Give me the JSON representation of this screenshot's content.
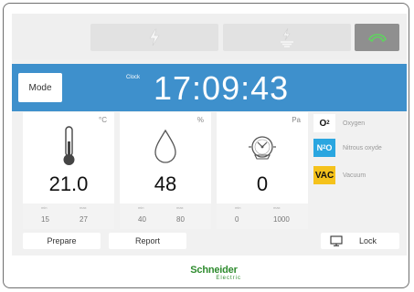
{
  "header": {
    "mode_label": "Mode",
    "clock_label": "Clock",
    "clock_time": "17:09:43",
    "accent_color": "#3e90cc"
  },
  "topbar": {
    "buttons": [
      {
        "icon": "lightning-icon"
      },
      {
        "icon": "ground-lightning-icon"
      },
      {
        "icon": "phone-hook-icon"
      }
    ]
  },
  "cards": [
    {
      "name": "temperature",
      "unit": "°C",
      "icon": "thermometer-icon",
      "value": "21.0",
      "min_label": "min",
      "max_label": "max",
      "min": "15",
      "max": "27"
    },
    {
      "name": "humidity",
      "unit": "%",
      "icon": "droplet-icon",
      "value": "48",
      "min_label": "min",
      "max_label": "max",
      "min": "40",
      "max": "80"
    },
    {
      "name": "pressure",
      "unit": "Pa",
      "icon": "gauge-icon",
      "value": "0",
      "min_label": "min",
      "max_label": "max",
      "min": "0",
      "max": "1000"
    }
  ],
  "gases": [
    {
      "symbol": "O2",
      "name": "Oxygen",
      "color": "#ffffff"
    },
    {
      "symbol": "N2O",
      "name": "Nitrous oxyde",
      "color": "#2aa6e0"
    },
    {
      "symbol": "VAC",
      "name": "Vacuum",
      "color": "#f5c21b"
    }
  ],
  "footer": {
    "prepare_label": "Prepare",
    "report_label": "Report",
    "lock_label": "Lock"
  },
  "brand": {
    "name": "Schneider",
    "sub": "Electric",
    "color": "#2e8b2e"
  }
}
